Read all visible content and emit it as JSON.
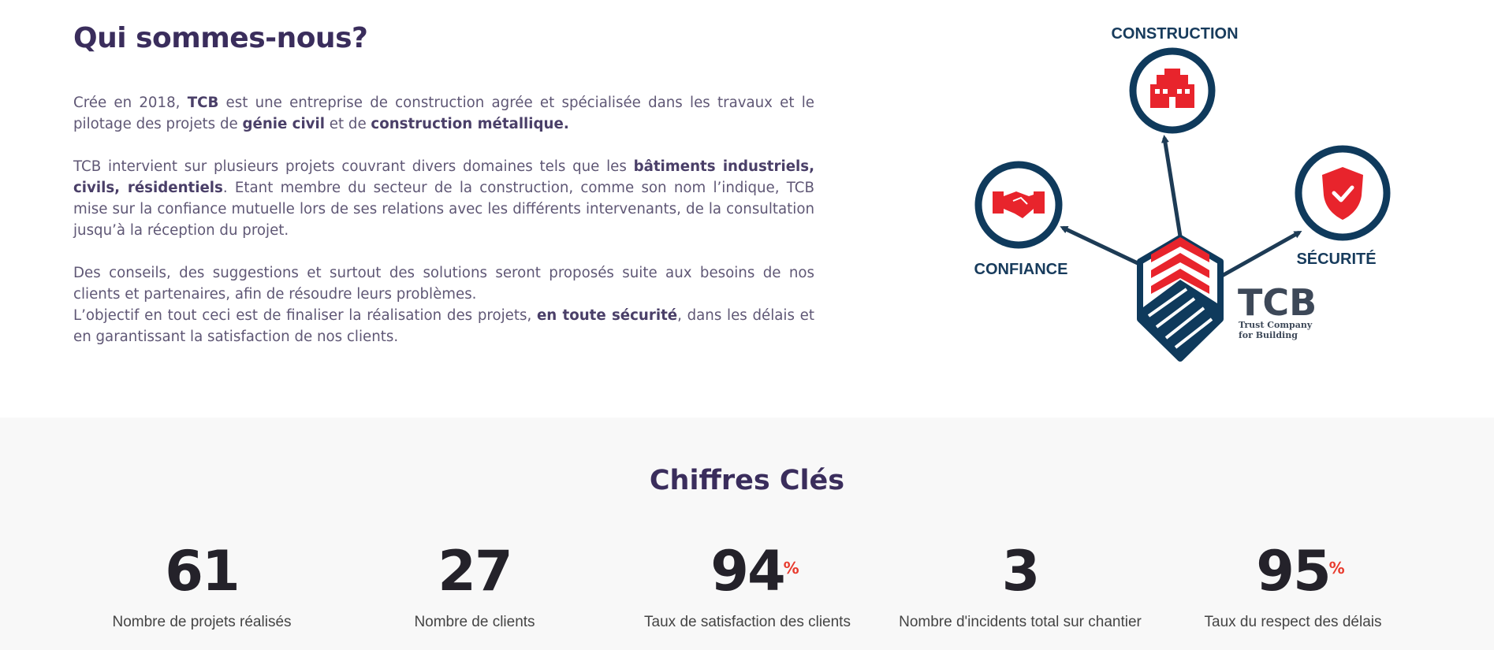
{
  "about": {
    "title": "Qui sommes-nous?",
    "p1": {
      "t1": "Crée en 2018, ",
      "b1": "TCB",
      "t2": " est une entreprise de construction agrée et spécialisée dans les travaux et le pilotage des projets de ",
      "b2": "génie civil",
      "t3": " et de ",
      "b3": "construction métallique."
    },
    "p2": {
      "t1": "TCB intervient sur plusieurs projets couvrant divers domaines tels que les ",
      "b1": "bâtiments industriels, civils, résidentiels",
      "t2": ". Etant membre du secteur de la construction, comme son nom l’indique, TCB mise sur la confiance mutuelle lors de ses relations avec les différents intervenants, de la consultation jusqu’à la réception du projet."
    },
    "p3": {
      "t1": "Des conseils, des suggestions et surtout des solutions seront proposés suite aux besoins de nos clients et partenaires, afin de résoudre leurs problèmes."
    },
    "p4": {
      "t1": "L’objectif en tout ceci est de finaliser la réalisation des projets, ",
      "b1": "en toute sécurité",
      "t2": ", dans les délais et en garantissant la satisfaction de nos clients."
    }
  },
  "figure": {
    "construction": "CONSTRUCTION",
    "confiance": "CONFIANCE",
    "securite": "SÉCURITÉ",
    "logo_name": "TCB",
    "logo_tag1": "Trust Company",
    "logo_tag2": "for Building",
    "icons": [
      "building-icon",
      "handshake-icon",
      "shield-check-icon"
    ],
    "colors": {
      "navy": "#0f3a5c",
      "red": "#e8242c"
    }
  },
  "stats": {
    "title": "Chiffres Clés",
    "items": [
      {
        "value": "61",
        "suffix": "",
        "label": "Nombre de projets réalisés"
      },
      {
        "value": "27",
        "suffix": "",
        "label": "Nombre de clients"
      },
      {
        "value": "94",
        "suffix": "%",
        "label": "Taux de satisfaction des clients"
      },
      {
        "value": "3",
        "suffix": "",
        "label": "Nombre d'incidents total sur chantier"
      },
      {
        "value": "95",
        "suffix": "%",
        "label": "Taux du respect des délais"
      }
    ],
    "colors": {
      "accent": "#e83b2e",
      "title": "#3a2d5c"
    }
  }
}
